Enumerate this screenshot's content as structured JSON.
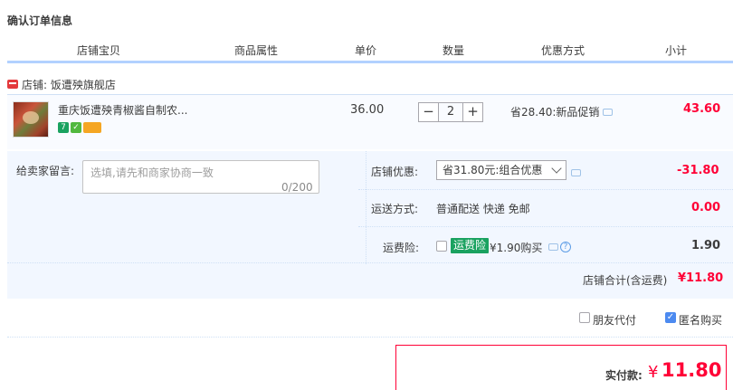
{
  "page_title": "确认订单信息",
  "columns": [
    "店铺宝贝",
    "商品属性",
    "单价",
    "数量",
    "优惠方式",
    "小计"
  ],
  "shop": {
    "label": "店铺: 饭遭殃旗舰店"
  },
  "item": {
    "title": "重庆饭遭殃青椒酱自制农...",
    "badges": [
      "7",
      "",
      ""
    ],
    "price": "36.00",
    "qty_minus": "−",
    "qty_value": "2",
    "qty_plus": "+",
    "promo": "省28.40:新品促销",
    "subtotal": "43.60"
  },
  "message": {
    "label": "给卖家留言:",
    "placeholder": "选填,请先和商家协商一致",
    "count": "0/200"
  },
  "discount": {
    "label": "店铺优惠:",
    "selected": "省31.80元:组合优惠",
    "value": "-31.80"
  },
  "shipping": {
    "label": "运送方式:",
    "method": "普通配送 快递 免邮",
    "value": "0.00"
  },
  "insurance": {
    "label": "运费险:",
    "badge": "运费险",
    "text": "¥1.90购买",
    "help": "?",
    "value": "1.90",
    "checked": false
  },
  "shop_total": {
    "label": "店铺合计(含运费)",
    "value": "¥11.80"
  },
  "options": {
    "friend_pay": "朋友代付",
    "friend_pay_checked": false,
    "anonymous": "匿名购买",
    "anonymous_checked": true,
    "check_mark": "✓"
  },
  "pay": {
    "label": "实付款:",
    "currency": "¥",
    "amount": "11.80"
  },
  "colors": {
    "price_red": "#ff0036",
    "panel_bg": "#f2f7ff",
    "row_bg": "#f9fbff",
    "check_blue": "#4c8af0",
    "badge_green": "#1aa260"
  }
}
